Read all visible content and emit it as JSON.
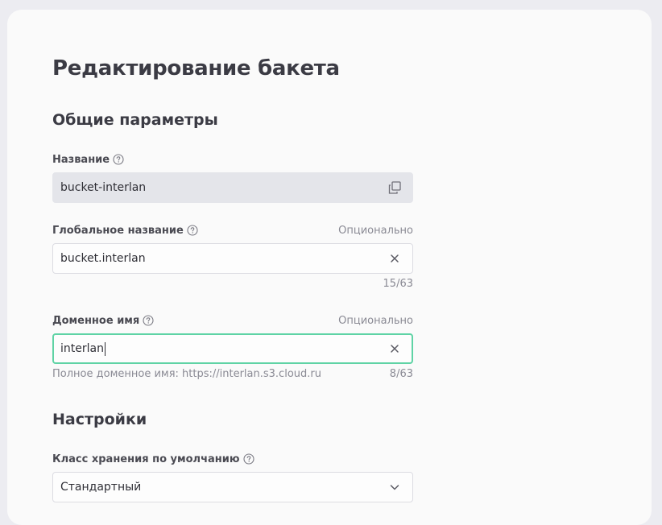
{
  "page": {
    "title": "Редактирование бакета"
  },
  "sections": {
    "general": "Общие параметры",
    "settings": "Настройки"
  },
  "fields": {
    "name": {
      "label": "Название",
      "value": "bucket-interlan",
      "icon": "copy-icon"
    },
    "global_name": {
      "label": "Глобальное название",
      "optional": "Опционально",
      "value": "bucket.interlan",
      "counter": "15/63",
      "icon": "clear-icon"
    },
    "domain_name": {
      "label": "Доменное имя",
      "optional": "Опционально",
      "value": "interlan",
      "hint": "Полное доменное имя: https://interlan.s3.cloud.ru",
      "counter": "8/63",
      "icon": "clear-icon"
    },
    "storage_class": {
      "label": "Класс хранения по умолчанию",
      "value": "Стандартный",
      "icon": "chevron-down-icon"
    }
  },
  "colors": {
    "background": "#ececf1",
    "panel": "#fafafa",
    "focus_border": "#5fd3a5",
    "readonly_field": "#e4e5ea",
    "text": "#3b3b44",
    "muted": "#8a8a94"
  }
}
